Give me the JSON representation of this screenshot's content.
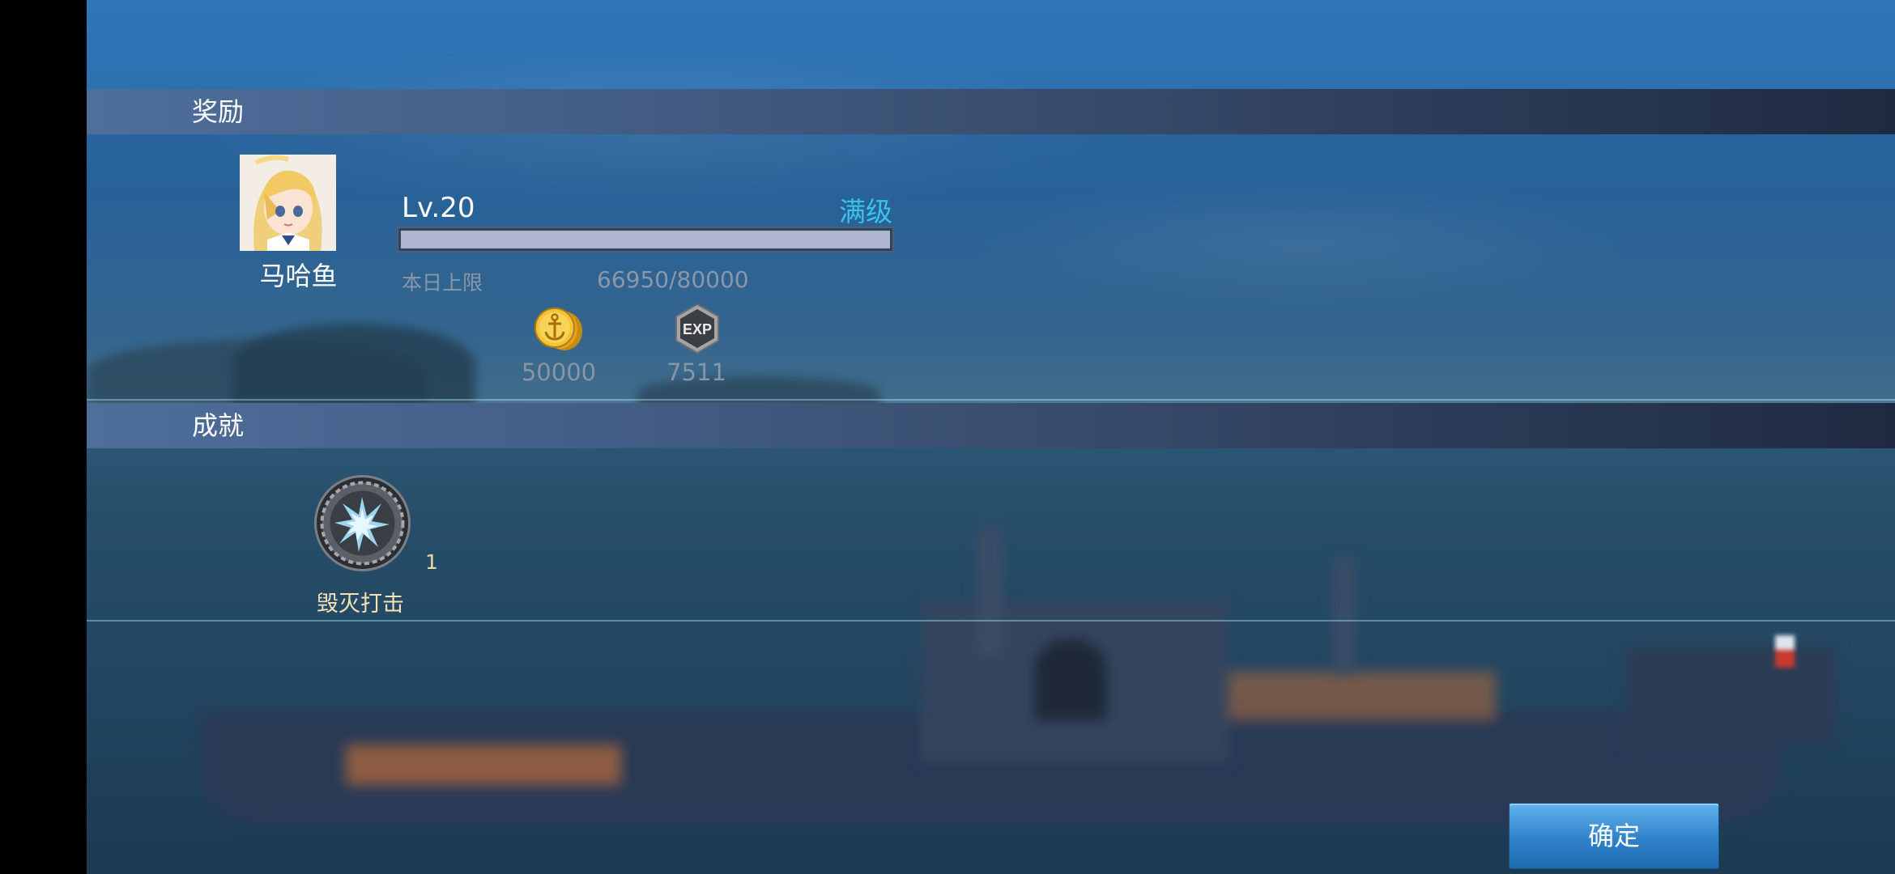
{
  "sections": {
    "reward_title": "奖励",
    "achievement_title": "成就"
  },
  "character": {
    "name": "马哈鱼",
    "level": "Lv.20",
    "max_level_label": "满级",
    "xp_progress": 1.0,
    "daily_cap_label": "本日上限",
    "daily_cap_value": "66950/80000"
  },
  "rewards": [
    {
      "icon": "anchor-coin-icon",
      "value": "50000"
    },
    {
      "icon": "exp-badge-icon",
      "value": "7511"
    }
  ],
  "achievement": {
    "icon": "destruction-strike-medal-icon",
    "count": "1",
    "label": "毁灭打击"
  },
  "actions": {
    "confirm_label": "确定"
  },
  "colors": {
    "accent_max_level": "#39c2ea",
    "button_blue": "#2f82c9",
    "section_bar": "#44608a"
  }
}
